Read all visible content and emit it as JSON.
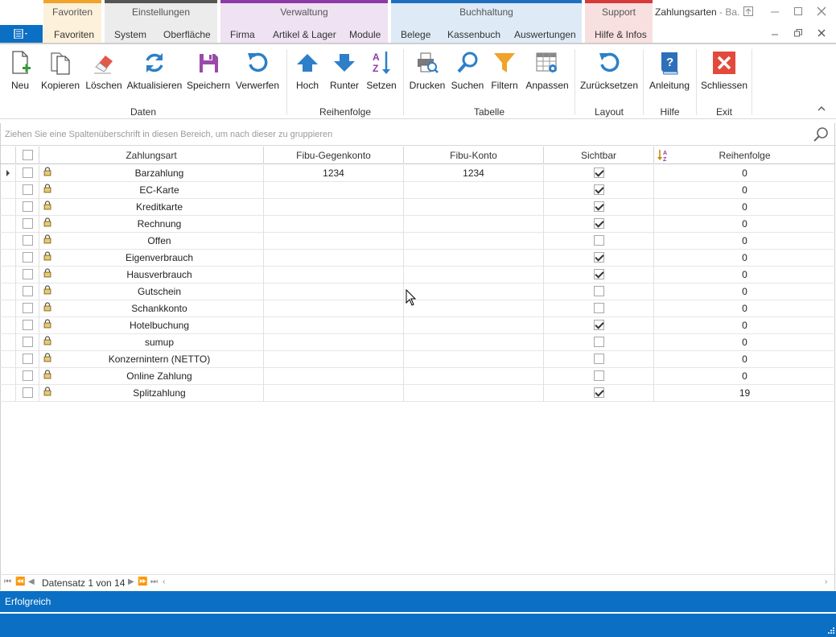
{
  "window": {
    "title": "Zahlungsarten",
    "title_suffix": " - Ba..."
  },
  "categories": [
    {
      "name": "Favoriten",
      "color": "#f0a22a",
      "bg": "#fdf1dc",
      "tabs": [
        "Favoriten"
      ]
    },
    {
      "name": "Einstellungen",
      "color": "#555555",
      "bg": "#ececec",
      "tabs": [
        "System",
        "Oberfläche"
      ]
    },
    {
      "name": "Verwaltung",
      "color": "#8d3aa6",
      "bg": "#efe2f2",
      "tabs": [
        "Firma",
        "Artikel & Lager",
        "Module"
      ]
    },
    {
      "name": "Buchhaltung",
      "color": "#1f6fc1",
      "bg": "#deebf7",
      "tabs": [
        "Belege",
        "Kassenbuch",
        "Auswertungen"
      ]
    },
    {
      "name": "Support",
      "color": "#d63a3a",
      "bg": "#f9e0e0",
      "tabs": [
        "Hilfe & Infos"
      ]
    }
  ],
  "ribbon": {
    "buttons": [
      "Neu",
      "Kopieren",
      "Löschen",
      "Aktualisieren",
      "Speichern",
      "Verwerfen",
      "Hoch",
      "Runter",
      "Setzen",
      "Drucken",
      "Suchen",
      "Filtern",
      "Anpassen",
      "Zurücksetzen",
      "Anleitung",
      "Schliessen"
    ],
    "groups": [
      "Daten",
      "Reihenfolge",
      "Tabelle",
      "Layout",
      "Hilfe",
      "Exit"
    ]
  },
  "group_panel": {
    "hint": "Ziehen Sie eine Spaltenüberschrift in diesen Bereich, um nach dieser zu gruppieren"
  },
  "grid": {
    "columns": [
      "Zahlungsart",
      "Fibu-Gegenkonto",
      "Fibu-Konto",
      "Sichtbar",
      "Reihenfolge"
    ],
    "rows": [
      {
        "name": "Barzahlung",
        "gegenkonto": "1234",
        "konto": "1234",
        "sichtbar": true,
        "reihenfolge": "0"
      },
      {
        "name": "EC-Karte",
        "gegenkonto": "",
        "konto": "",
        "sichtbar": true,
        "reihenfolge": "0"
      },
      {
        "name": "Kreditkarte",
        "gegenkonto": "",
        "konto": "",
        "sichtbar": true,
        "reihenfolge": "0"
      },
      {
        "name": "Rechnung",
        "gegenkonto": "",
        "konto": "",
        "sichtbar": true,
        "reihenfolge": "0"
      },
      {
        "name": "Offen",
        "gegenkonto": "",
        "konto": "",
        "sichtbar": false,
        "reihenfolge": "0"
      },
      {
        "name": "Eigenverbrauch",
        "gegenkonto": "",
        "konto": "",
        "sichtbar": true,
        "reihenfolge": "0"
      },
      {
        "name": "Hausverbrauch",
        "gegenkonto": "",
        "konto": "",
        "sichtbar": true,
        "reihenfolge": "0"
      },
      {
        "name": "Gutschein",
        "gegenkonto": "",
        "konto": "",
        "sichtbar": false,
        "reihenfolge": "0"
      },
      {
        "name": "Schankkonto",
        "gegenkonto": "",
        "konto": "",
        "sichtbar": false,
        "reihenfolge": "0"
      },
      {
        "name": "Hotelbuchung",
        "gegenkonto": "",
        "konto": "",
        "sichtbar": true,
        "reihenfolge": "0"
      },
      {
        "name": "sumup",
        "gegenkonto": "",
        "konto": "",
        "sichtbar": false,
        "reihenfolge": "0"
      },
      {
        "name": "Konzernintern (NETTO)",
        "gegenkonto": "",
        "konto": "",
        "sichtbar": false,
        "reihenfolge": "0"
      },
      {
        "name": "Online Zahlung",
        "gegenkonto": "",
        "konto": "",
        "sichtbar": false,
        "reihenfolge": "0"
      },
      {
        "name": "Splitzahlung",
        "gegenkonto": "",
        "konto": "",
        "sichtbar": true,
        "reihenfolge": "19"
      }
    ]
  },
  "navigator": {
    "text": "Datensatz 1 von 14"
  },
  "status": {
    "text": "Erfolgreich"
  },
  "colors": {
    "accent": "#0b6fc4"
  }
}
